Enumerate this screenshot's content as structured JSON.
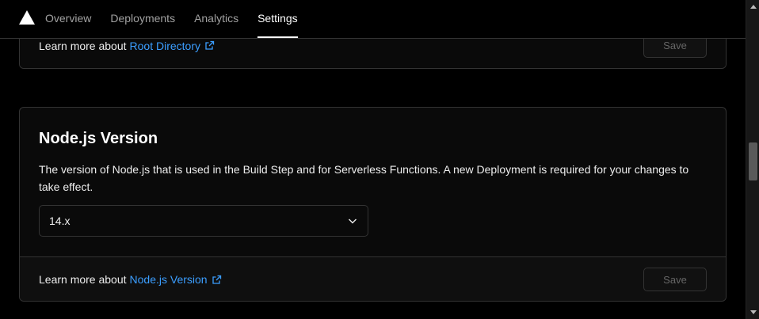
{
  "nav": {
    "logo_icon": "triangle-logo-icon",
    "tabs": [
      {
        "label": "Overview",
        "active": false
      },
      {
        "label": "Deployments",
        "active": false
      },
      {
        "label": "Analytics",
        "active": false
      },
      {
        "label": "Settings",
        "active": true
      }
    ]
  },
  "root_directory_card": {
    "learn_prefix": "Learn more about",
    "link_label": "Root Directory",
    "save_label": "Save"
  },
  "node_version_card": {
    "title": "Node.js Version",
    "description": "The version of Node.js that is used in the Build Step and for Serverless Functions. A new Deployment is required for your changes to take effect.",
    "selected_version": "14.x",
    "learn_prefix": "Learn more about",
    "link_label": "Node.js Version",
    "save_label": "Save"
  },
  "colors": {
    "background": "#000000",
    "link": "#3b9eff",
    "border": "#333333"
  }
}
